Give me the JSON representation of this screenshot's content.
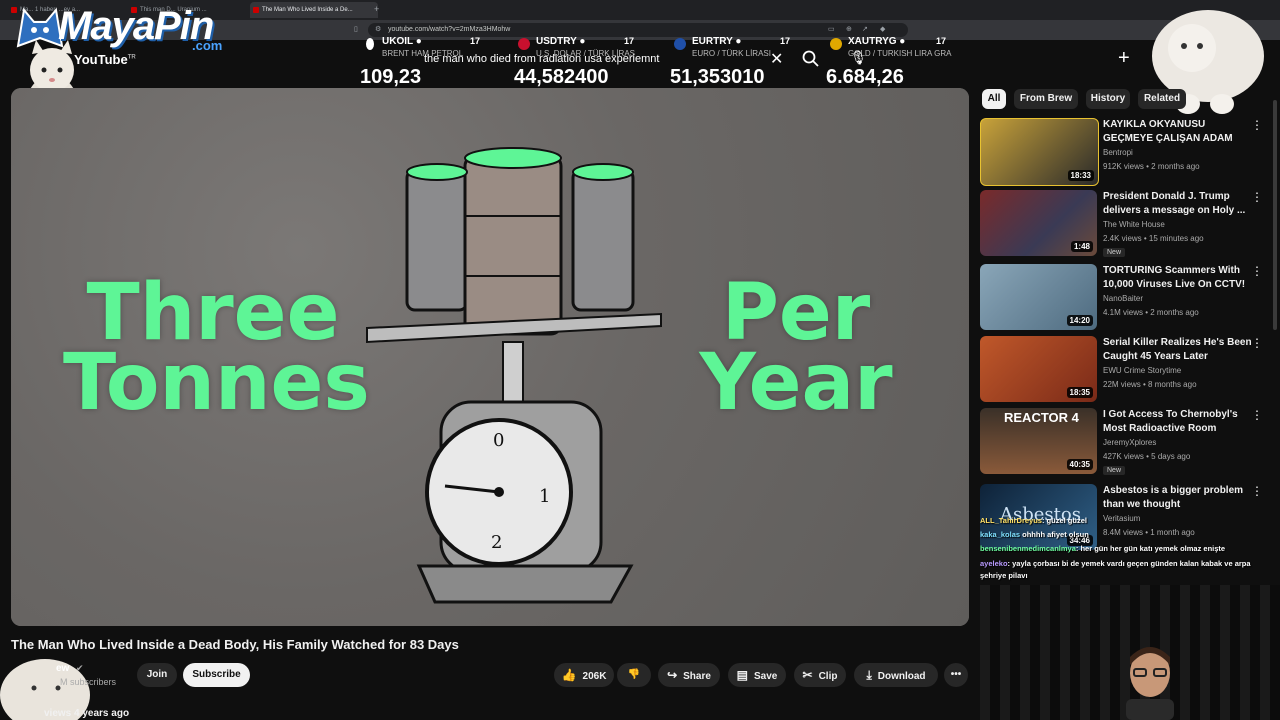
{
  "browser": {
    "tabs": [
      {
        "label": "Ma... 1 haber: ...ev a...",
        "active": false
      },
      {
        "label": "This man D... Uranium ...",
        "active": false
      },
      {
        "label": "The Man Who Lived Inside a De...",
        "active": true
      }
    ],
    "new_tab": "+",
    "url": "youtube.com/watch?v=2mMza3HMohw"
  },
  "overlay": {
    "logo_text": "MayaPin",
    "logo_sub": ".com",
    "tickers": [
      {
        "symbol": "UKOIL ●",
        "sub": "BRENT HAM PETROL",
        "value": "109,23",
        "color": "#ffffff"
      },
      {
        "symbol": "USDTRY ●",
        "sub": "U.S. DOLAR / TÜRK LİRAS",
        "value": "44,582400",
        "color": "#c8102e"
      },
      {
        "symbol": "EURTRY ●",
        "sub": "EURO / TÜRK LİRASI",
        "value": "51,353010",
        "color": "#1f4fa8"
      },
      {
        "symbol": "XAUTRYG ●",
        "sub": "GOLD / TURKISH LIRA GRA",
        "value": "6.684,26",
        "color": "#e0a800"
      }
    ],
    "ticker_mark": "17"
  },
  "youtube": {
    "logo": "YouTube",
    "logo_region": "TR",
    "search_query": "the man who died from radiation usa experiemnt",
    "video": {
      "title": "The Man Who Lived Inside a Dead Body, His Family Watched for 83 Days",
      "overlay_left": "Three Tonnes",
      "overlay_right": "Per Year"
    },
    "channel": {
      "name": "ew",
      "subscribers": "M subscribers"
    },
    "actions": {
      "join": "Join",
      "subscribe": "Subscribe",
      "likes": "206K",
      "share": "Share",
      "save": "Save",
      "clip": "Clip",
      "download": "Download"
    },
    "views_line": "views  4 years ago",
    "chips": [
      "All",
      "From Brew",
      "History",
      "Related"
    ],
    "recommendations": [
      {
        "title": "KAYIKLA OKYANUSU GEÇMEYE ÇALIŞAN ADAM",
        "channel": "Bentropi",
        "meta": "912K views • 2 months ago",
        "duration": "18:33",
        "badge": "",
        "thumb": "#c8a23a"
      },
      {
        "title": "President Donald J. Trump delivers a message on Holy ...",
        "channel": "The White House",
        "meta": "2.4K views • 15 minutes ago",
        "duration": "1:48",
        "badge": "New",
        "thumb": "#6b4a3a"
      },
      {
        "title": "TORTURING Scammers With 10,000 Viruses Live On CCTV!",
        "channel": "NanoBaiter",
        "meta": "4.1M views • 2 months ago",
        "duration": "14:20",
        "badge": "",
        "thumb": "#6f8c9f"
      },
      {
        "title": "Serial Killer Realizes He's Been Caught 45 Years Later",
        "channel": "EWU Crime Storytime",
        "meta": "22M views • 8 months ago",
        "duration": "18:35",
        "badge": "",
        "thumb": "#a04025"
      },
      {
        "title": "I Got Access To Chernobyl's Most Radioactive Room",
        "channel": "JeremyXplores",
        "meta": "427K views • 5 days ago",
        "duration": "40:35",
        "badge": "New",
        "thumb": "#8a5a3a",
        "thumb_text": "REACTOR 4"
      },
      {
        "title": "Asbestos is a bigger problem than we thought",
        "channel": "Veritasium",
        "meta": "8.4M views • 1 month ago",
        "duration": "34:46",
        "badge": "",
        "thumb": "#1d3550",
        "thumb_text": "Asbestos"
      }
    ]
  },
  "chat": [
    {
      "user": "ALL_TahirDreyus",
      "text": ": güzel güzel"
    },
    {
      "user": "kaka_kolas",
      "text": " ohhhh afiyet olsun"
    },
    {
      "user": "bensenibenmedimcanlmya",
      "text": ": her gün her gün katı yemek olmaz enişte"
    },
    {
      "user": "ayeleko",
      "text": ": yayla çorbası bi de yemek vardı geçen günden kalan kabak ve arpa şehriye pilavı"
    }
  ]
}
